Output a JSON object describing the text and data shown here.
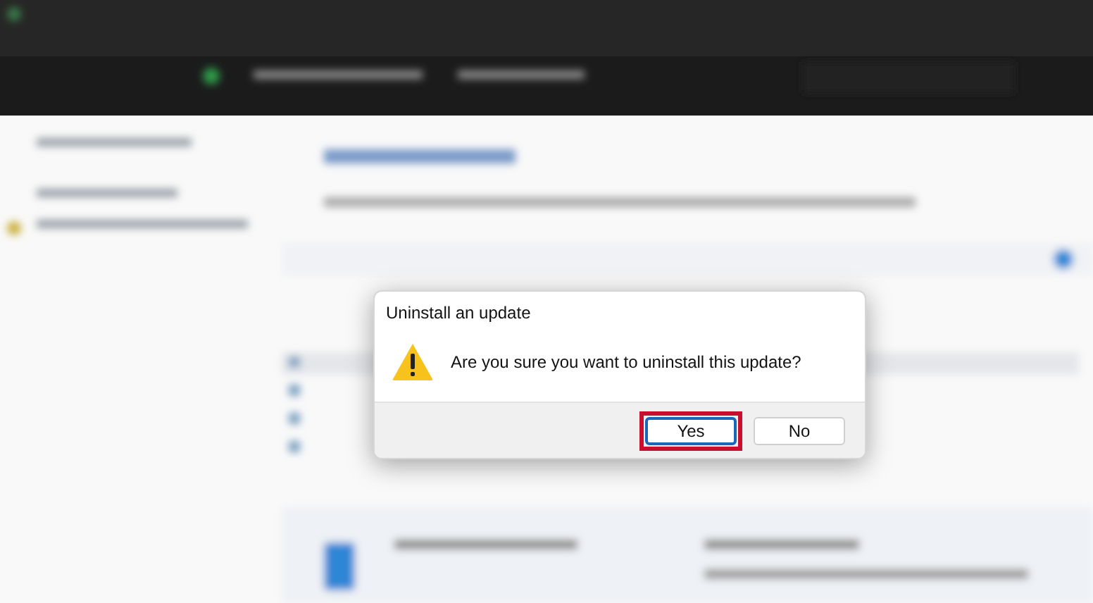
{
  "dialog": {
    "title": "Uninstall an update",
    "message": "Are you sure you want to uninstall this update?",
    "buttons": [
      {
        "label": "Yes",
        "default": true,
        "highlighted": true
      },
      {
        "label": "No",
        "default": false,
        "highlighted": false
      }
    ]
  }
}
